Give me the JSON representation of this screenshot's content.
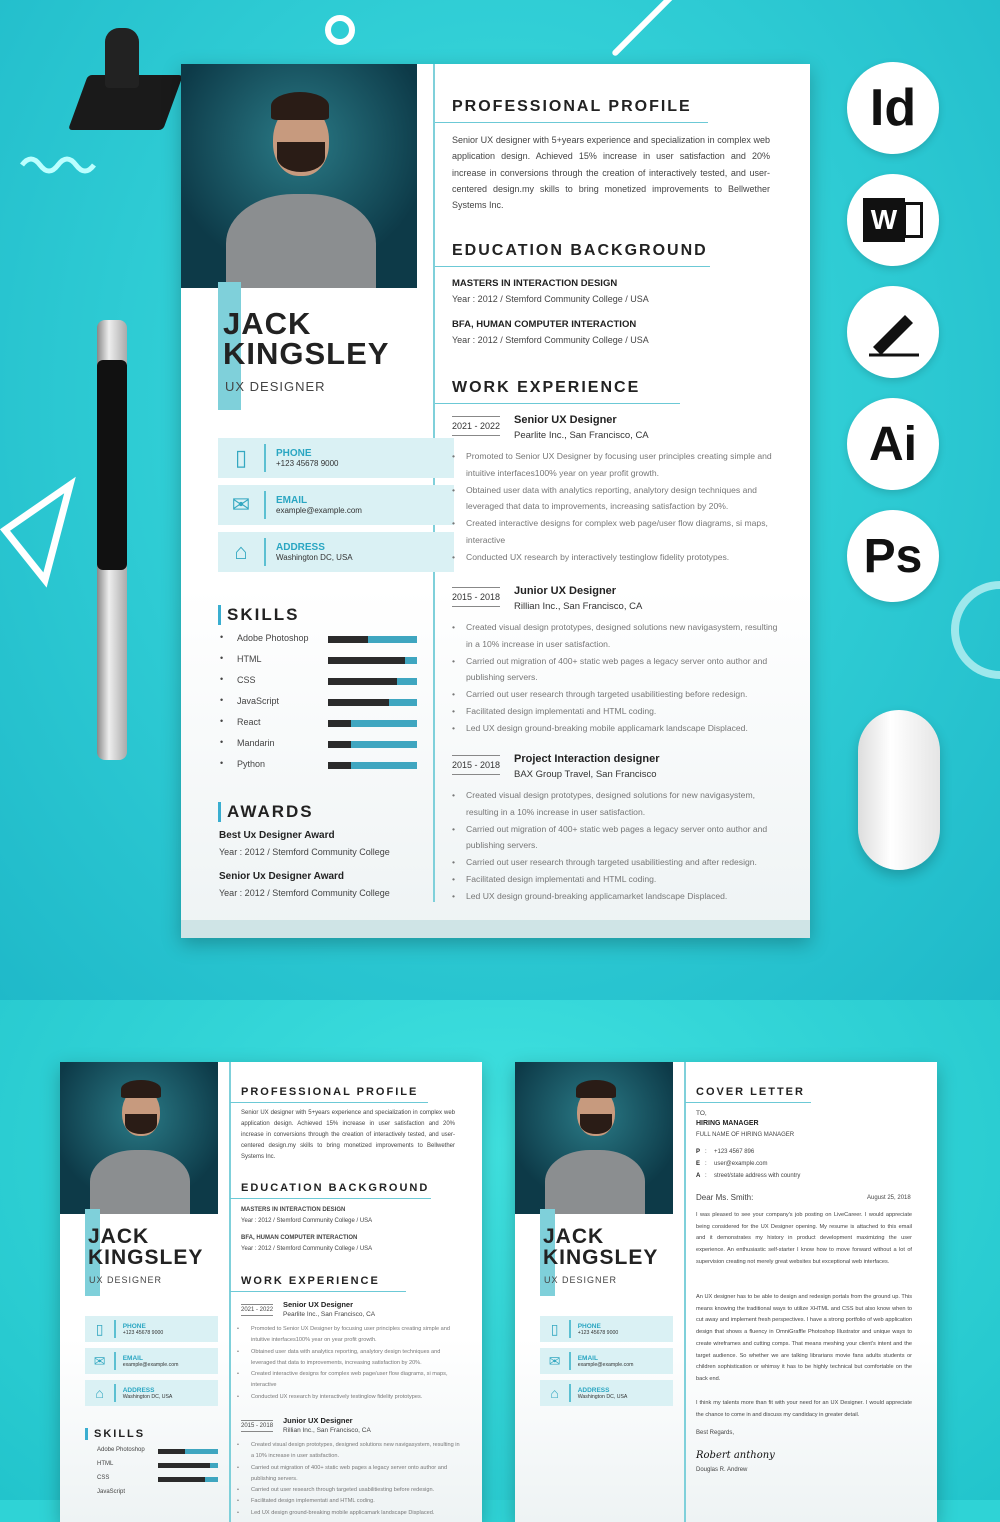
{
  "colors": {
    "accent": "#3aaed0",
    "background": "#2fd3d6",
    "dark": "#2b2b2b"
  },
  "resume": {
    "first_name": "JACK",
    "last_name": "KINGSLEY",
    "title": "UX DESIGNER",
    "contacts": [
      {
        "icon": "phone-icon",
        "label": "PHONE",
        "value": "+123 45678 9000"
      },
      {
        "icon": "email-icon",
        "label": "EMAIL",
        "value": "example@example.com"
      },
      {
        "icon": "home-icon",
        "label": "ADDRESS",
        "value": "Washington DC, USA"
      }
    ],
    "skills_title": "SKILLS",
    "skills": [
      {
        "name": "Adobe Photoshop",
        "level": 0.45
      },
      {
        "name": "HTML",
        "level": 0.86
      },
      {
        "name": "CSS",
        "level": 0.78
      },
      {
        "name": "JavaScript",
        "level": 0.69
      },
      {
        "name": "React",
        "level": 0.26
      },
      {
        "name": "Mandarin",
        "level": 0.26
      },
      {
        "name": "Python",
        "level": 0.26
      }
    ],
    "awards_title": "AWARDS",
    "awards": [
      {
        "name": "Best Ux Designer Award",
        "detail": "Year : 2012 / Stemford Community College"
      },
      {
        "name": "Senior Ux Designer Award",
        "detail": "Year : 2012 / Stemford Community College"
      }
    ],
    "profile_title": "PROFESSIONAL PROFILE",
    "profile": "Senior UX designer with 5+years experience and specialization in complex web application design. Achieved 15% increase in user satisfaction and 20% increase in conversions through the creation of interactively tested, and user-centered design.my skills to bring monetized improvements to Bellwether Systems Inc.",
    "education_title": "EDUCATION BACKGROUND",
    "education": [
      {
        "degree": "MASTERS IN INTERACTION DESIGN",
        "detail": "Year : 2012 / Stemford Community College / USA"
      },
      {
        "degree": "BFA, HUMAN COMPUTER INTERACTION",
        "detail": "Year : 2012 / Stemford Community College / USA"
      }
    ],
    "work_title": "WORK EXPERIENCE",
    "jobs": [
      {
        "dates": "2021 - 2022",
        "role": "Senior UX Designer",
        "company": "Pearlite Inc., San Francisco, CA",
        "bullets": [
          "Promoted to Senior UX Designer by focusing user principles creating simple and intuitive interfaces100% year on year profit growth.",
          "Obtained user data with analytics reporting, analytory design techniques and leveraged that data to improvements, increasing satisfaction by 20%.",
          "Created interactive designs for complex web page/user flow diagrams, si maps, interactive",
          "Conducted UX research by interactively testinglow fidelity prototypes."
        ]
      },
      {
        "dates": "2015 - 2018",
        "role": "Junior UX Designer",
        "company": "Rillian Inc., San Francisco, CA",
        "bullets": [
          "Created visual design prototypes, designed solutions new navigasystem, resulting in a 10% increase in user satisfaction.",
          "Carried out migration of 400+ static web pages a legacy server onto author and publishing servers.",
          "Carried out user research through targeted usabilitiesting before redesign.",
          "Facilitated design implementati and HTML coding.",
          "Led UX design ground-breaking mobile applicamark landscape Displaced."
        ]
      },
      {
        "dates": "2015 - 2018",
        "role": "Project Interaction designer",
        "company": "BAX Group Travel, San Francisco",
        "bullets": [
          "Created visual design prototypes, designed solutions for new navigasystem, resulting in a 10% increase in user satisfaction.",
          "Carried out migration of 400+ static web pages a legacy server onto author and publishing servers.",
          "Carried out user research through targeted usabilitiesting and after redesign.",
          "Facilitated design implementati and HTML coding.",
          "Led UX design ground-breaking applicamarket landscape Displaced."
        ]
      }
    ]
  },
  "app_icons": [
    {
      "icon": "indesign-icon",
      "text": "Id"
    },
    {
      "icon": "word-icon",
      "text": "W"
    },
    {
      "icon": "pen-sign-icon",
      "text": ""
    },
    {
      "icon": "illustrator-icon",
      "text": "Ai"
    },
    {
      "icon": "photoshop-icon",
      "text": "Ps"
    }
  ],
  "cover_letter": {
    "title": "COVER LETTER",
    "to": "TO,",
    "recipient": "HIRING MANAGER",
    "recipient_sub": "FULL NAME OF HIRING MANAGER",
    "contacts": [
      {
        "k": "P",
        "v": "+123 4567 896"
      },
      {
        "k": "E",
        "v": "user@example.com"
      },
      {
        "k": "A",
        "v": "street/state address with country"
      }
    ],
    "salutation": "Dear Ms. Smith:",
    "date": "August 25, 2018",
    "paragraphs": [
      "I was pleased to see your company's job posting on LiveCareer. I would appreciate being considered for the UX Designer opening. My resume is attached to this email and it demonstrates my history in product development maximizing the user experience. An enthusiastic self-starter I know how to move forward without a lot of supervision creating not merely great websites but exceptional web interfaces.",
      "An UX designer has to be able to design and redesign portals from the ground up. This means knowing the traditional ways to utilize XHTML and CSS but also know when to cut away and implement fresh perspectives. I have a strong portfolio of web application design that shows a fluency in OmniGraffle Photoshop Illustrator and unique ways to create wireframes and cutting comps. That means meshing your client's intent and the target audience. So whether we are talking librarians movie fans adults students or children sophistication or whimsy it has to be highly technical but comfortable on the back end.",
      "I think my talents more than fit with your need for an UX Designer. I would appreciate the chance to come in and discuss my candidacy in greater detail."
    ],
    "closing": "Best Regards,",
    "signature": "Robert anthony",
    "signer": "Douglas R. Andrew"
  }
}
